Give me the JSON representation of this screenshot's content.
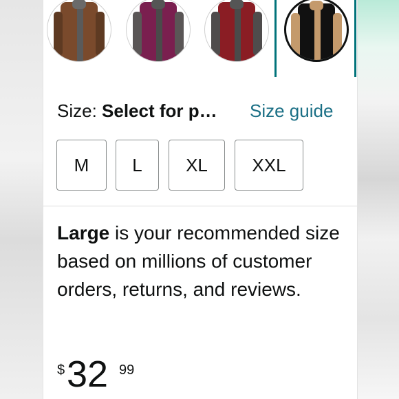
{
  "swatches": [
    {
      "name": "brown",
      "body": "#7a4a2c",
      "sleeve": "#5e3a22",
      "collar": "#6a6a6a",
      "stripe": "#5a5a5a"
    },
    {
      "name": "wine",
      "body": "#7a1f4f",
      "sleeve": "#5a5656",
      "collar": "#555555",
      "stripe": "#4a4a4a"
    },
    {
      "name": "red",
      "body": "#8a1d24",
      "sleeve": "#4f4c4c",
      "collar": "#555555",
      "stripe": "#4a4a4a"
    },
    {
      "name": "leopard",
      "body": "#111111",
      "sleeve": "#c49a6c",
      "collar": "#c49a6c",
      "stripe": "#c49a6c",
      "selected": true
    }
  ],
  "size": {
    "label": "Size: ",
    "value": "Select for p…",
    "guide": "Size guide",
    "options": [
      "M",
      "L",
      "XL",
      "XXL"
    ]
  },
  "recommendation": {
    "bold": "Large",
    "text": " is your recommended size based on millions of customer orders, returns, and reviews."
  },
  "price": {
    "symbol": "$",
    "whole": "32",
    "fraction": "99"
  },
  "colors": {
    "accent": "#00737a",
    "link": "#1a6f85",
    "text": "#0f1111"
  }
}
